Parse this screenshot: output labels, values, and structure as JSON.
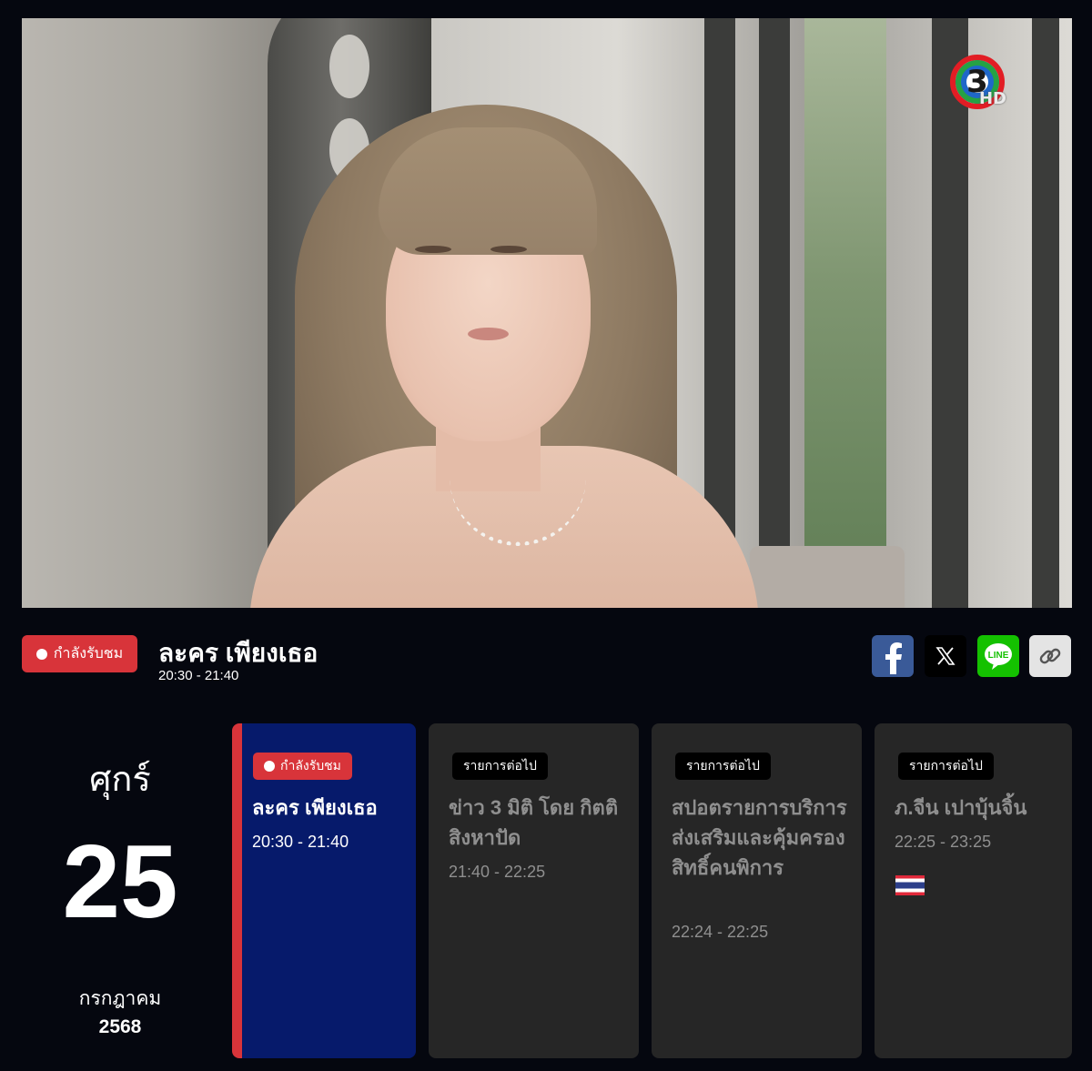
{
  "player": {
    "channel_logo_number": "3",
    "channel_logo_hd": "HD"
  },
  "now_playing": {
    "badge": "กำลังรับชม",
    "title": "ละคร เพียงเธอ",
    "time": "20:30 - 21:40"
  },
  "share": [
    {
      "icon": "facebook-icon"
    },
    {
      "icon": "x-icon"
    },
    {
      "icon": "line-icon",
      "label": "LINE"
    },
    {
      "icon": "link-icon"
    }
  ],
  "date": {
    "weekday": "ศุกร์",
    "day": "25",
    "month": "กรกฎาคม",
    "year": "2568"
  },
  "schedule": [
    {
      "badge": "กำลังรับชม",
      "title": "ละคร เพียงเธอ",
      "time": "20:30 - 21:40",
      "current": true
    },
    {
      "badge": "รายการต่อไป",
      "title": "ข่าว 3 มิติ โดย กิตติ สิงหาปัด",
      "time": "21:40 - 22:25"
    },
    {
      "badge": "รายการต่อไป",
      "title": "สปอตรายการบริการส่งเสริมและคุ้มครองสิทธิ์คนพิการ",
      "time": "22:24 - 22:25"
    },
    {
      "badge": "รายการต่อไป",
      "title": "ภ.จีน เปาบุ้นจิ้น",
      "time": "22:25 - 23:25",
      "rating_icon": "thai-flag-icon"
    }
  ],
  "colors": {
    "accent_red": "#d8343a",
    "current_card": "#061a6b",
    "card_bg": "#262626",
    "page_bg": "#05070f"
  }
}
